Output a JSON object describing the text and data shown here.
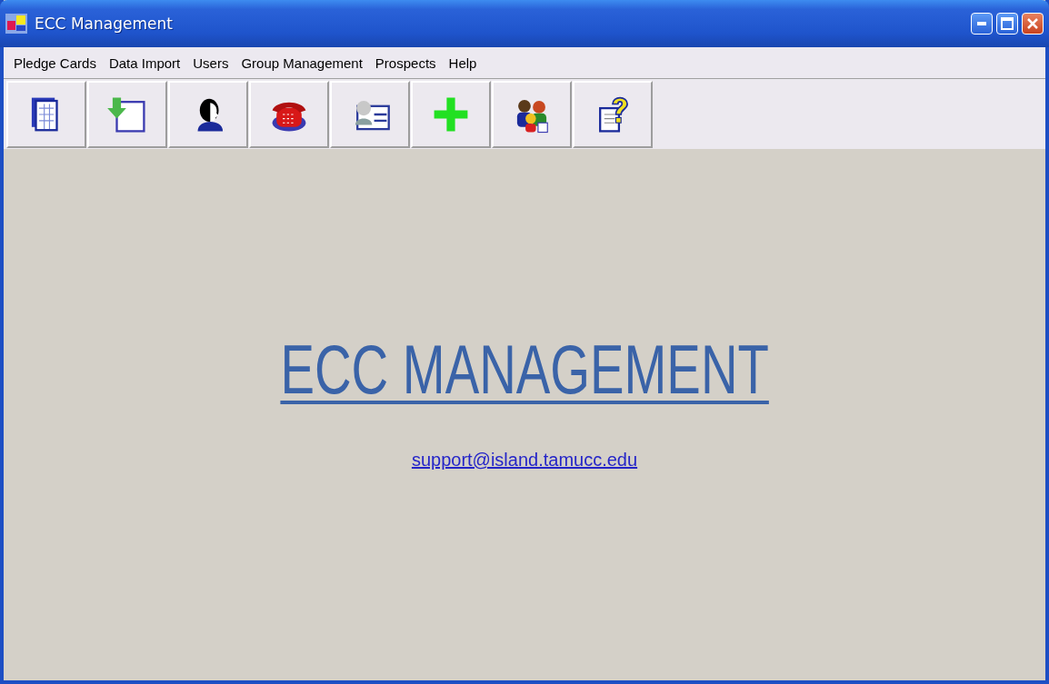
{
  "window": {
    "title": "ECC Management"
  },
  "menu": [
    "Pledge Cards",
    "Data Import",
    "Users",
    "Group Management",
    "Prospects",
    "Help"
  ],
  "main": {
    "heading": "ECC MANAGEMENT",
    "email": "support@island.tamucc.edu"
  }
}
